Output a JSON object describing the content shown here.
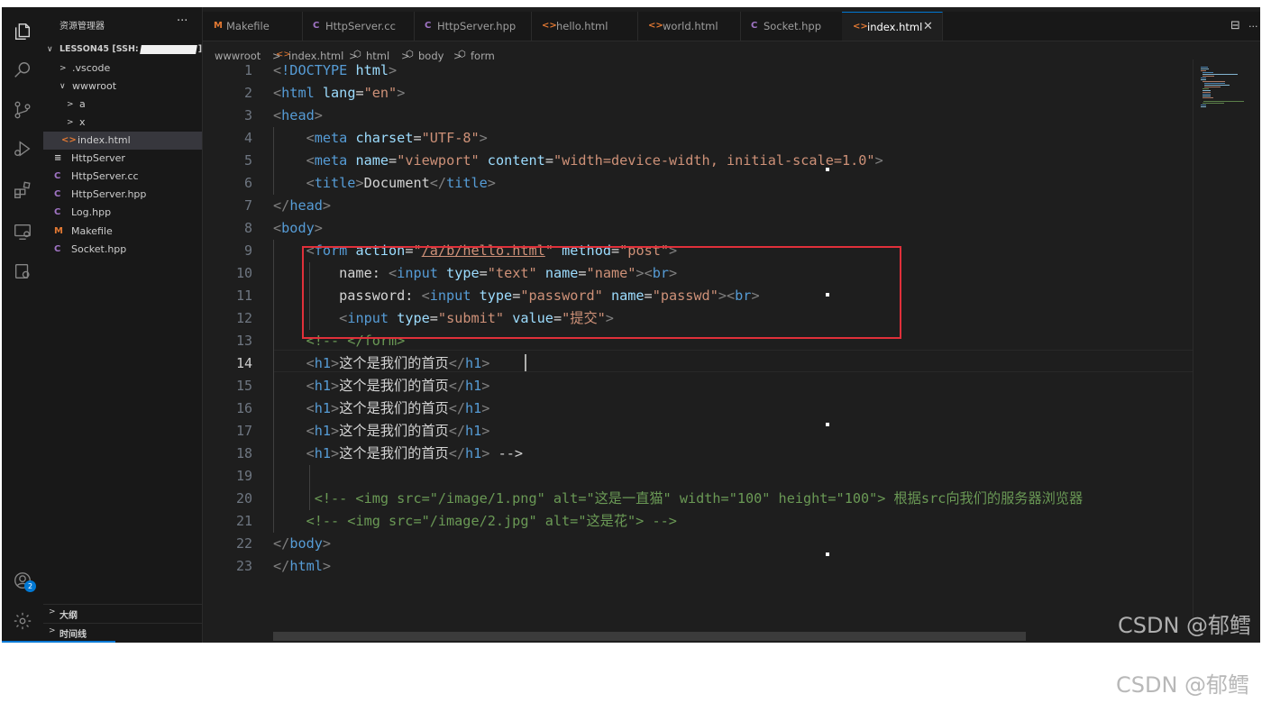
{
  "sidebar": {
    "title": "资源管理器",
    "more": "···",
    "root": "LESSON45 [SSH:",
    "root_suffix": "]",
    "items": [
      {
        "label": ".vscode",
        "twisty": ">",
        "icon": ""
      },
      {
        "label": "wwwroot",
        "twisty": "∨",
        "icon": ""
      },
      {
        "label": "a",
        "twisty": ">",
        "icon": ""
      },
      {
        "label": "x",
        "twisty": ">",
        "icon": ""
      },
      {
        "label": "index.html",
        "twisty": "",
        "icon": "<>"
      },
      {
        "label": "HttpServer",
        "twisty": "",
        "icon": "≡"
      },
      {
        "label": "HttpServer.cc",
        "twisty": "",
        "icon": "C"
      },
      {
        "label": "HttpServer.hpp",
        "twisty": "",
        "icon": "C"
      },
      {
        "label": "Log.hpp",
        "twisty": "",
        "icon": "C"
      },
      {
        "label": "Makefile",
        "twisty": "",
        "icon": "M"
      },
      {
        "label": "Socket.hpp",
        "twisty": "",
        "icon": "C"
      }
    ],
    "outline": "大纲",
    "timeline": "时间线"
  },
  "tabs": [
    {
      "label": "Makefile",
      "icon": "M"
    },
    {
      "label": "HttpServer.cc",
      "icon": "C"
    },
    {
      "label": "HttpServer.hpp",
      "icon": "C"
    },
    {
      "label": "hello.html",
      "icon": "<>"
    },
    {
      "label": "world.html",
      "icon": "<>"
    },
    {
      "label": "Socket.hpp",
      "icon": "C"
    },
    {
      "label": "index.html",
      "icon": "<>",
      "close": "✕"
    }
  ],
  "editor_actions": {
    "split": "⊟",
    "more": "···"
  },
  "breadcrumb": [
    "wwwroot",
    "index.html",
    "html",
    "body",
    "form"
  ],
  "breadcrumb_sep": ">",
  "badge_count": "2",
  "current_line": 14,
  "code_lines": [
    {
      "n": "1",
      "text": "<!DOCTYPE html>"
    },
    {
      "n": "2",
      "text": "<html lang=\"en\">"
    },
    {
      "n": "3",
      "text": "<head>"
    },
    {
      "n": "4",
      "text": "    <meta charset=\"UTF-8\">"
    },
    {
      "n": "5",
      "text": "    <meta name=\"viewport\" content=\"width=device-width, initial-scale=1.0\">"
    },
    {
      "n": "6",
      "text": "    <title>Document</title>"
    },
    {
      "n": "7",
      "text": "</head>"
    },
    {
      "n": "8",
      "text": "<body>"
    },
    {
      "n": "9",
      "text": "    <form action=\"/a/b/hello.html\" method=\"post\">"
    },
    {
      "n": "10",
      "text": "        name: <input type=\"text\" name=\"name\"><br>"
    },
    {
      "n": "11",
      "text": "        password: <input type=\"password\" name=\"passwd\"><br>"
    },
    {
      "n": "12",
      "text": "        <input type=\"submit\" value=\"提交\">"
    },
    {
      "n": "13",
      "text": "    <!-- </form>"
    },
    {
      "n": "14",
      "text": "    <h1>这个是我们的首页</h1>"
    },
    {
      "n": "15",
      "text": "    <h1>这个是我们的首页</h1>"
    },
    {
      "n": "16",
      "text": "    <h1>这个是我们的首页</h1>"
    },
    {
      "n": "17",
      "text": "    <h1>这个是我们的首页</h1>"
    },
    {
      "n": "18",
      "text": "    <h1>这个是我们的首页</h1> -->"
    },
    {
      "n": "19",
      "text": ""
    },
    {
      "n": "20",
      "text": "     <!-- <img src=\"/image/1.png\" alt=\"这是一直猫\" width=\"100\" height=\"100\"> 根据src向我们的服务器浏览器"
    },
    {
      "n": "21",
      "text": "    <!-- <img src=\"/image/2.jpg\" alt=\"这是花\"> -->"
    },
    {
      "n": "22",
      "text": "</body>"
    },
    {
      "n": "23",
      "text": "</html>"
    }
  ],
  "watermark": "CSDN @郁鳕",
  "colors": {
    "tag": "#569cd6",
    "attr": "#9cdcfe",
    "string": "#ce9178",
    "comment": "#6a9955",
    "bracket": "#808080",
    "highlight_box": "#e0303a",
    "accent": "#0078d4"
  }
}
